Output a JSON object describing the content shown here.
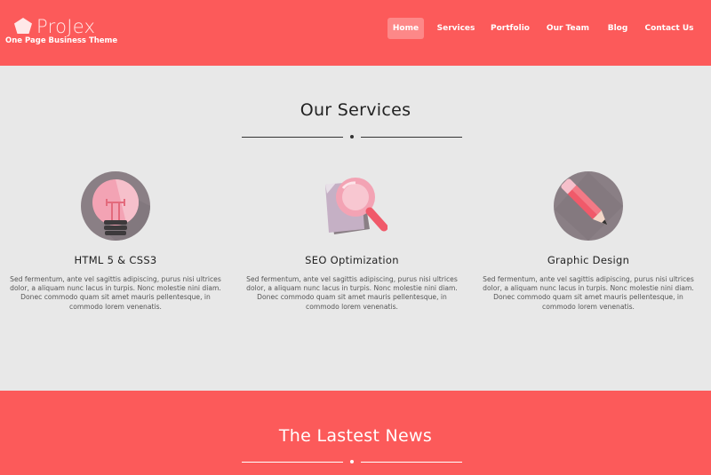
{
  "header": {
    "logo_name": "ProJex",
    "logo_tagline": "One Page Business Theme",
    "nav": [
      {
        "label": "Home",
        "active": true
      },
      {
        "label": "Services",
        "active": false
      },
      {
        "label": "Portfolio",
        "active": false
      },
      {
        "label": "Our Team",
        "active": false
      },
      {
        "label": "Blog",
        "active": false
      },
      {
        "label": "Contact Us",
        "active": false
      }
    ]
  },
  "services": {
    "title": "Our Services",
    "items": [
      {
        "icon": "lightbulb-icon",
        "title": "HTML 5 & CSS3",
        "description": "Sed fermentum, ante vel sagittis adipiscing, purus nisi ultrices dolor, a aliquam nunc lacus in turpis. Nonc molestie nini diam. Donec commodo quam sit amet mauris pellentesque, in commodo lorem venenatis."
      },
      {
        "icon": "magnifier-icon",
        "title": "SEO Optimization",
        "description": "Sed fermentum, ante vel sagittis adipiscing, purus nisi ultrices dolor, a aliquam nunc lacus in turpis. Nonc molestie nini diam. Donec commodo quam sit amet mauris pellentesque, in commodo lorem venenatis."
      },
      {
        "icon": "pencil-icon",
        "title": "Graphic Design",
        "description": "Sed fermentum, ante vel sagittis adipiscing, purus nisi ultrices dolor, a aliquam nunc lacus in turpis. Nonc molestie nini diam. Donec commodo quam sit amet mauris pellentesque, in commodo lorem venenatis."
      }
    ]
  },
  "news": {
    "title": "The Lastest News"
  },
  "colors": {
    "accent": "#fc5a5a",
    "background": "#e8e8e8",
    "icon_circle": "#8a7f85",
    "icon_pink": "#f3a3b4",
    "icon_red": "#f05a6a"
  }
}
